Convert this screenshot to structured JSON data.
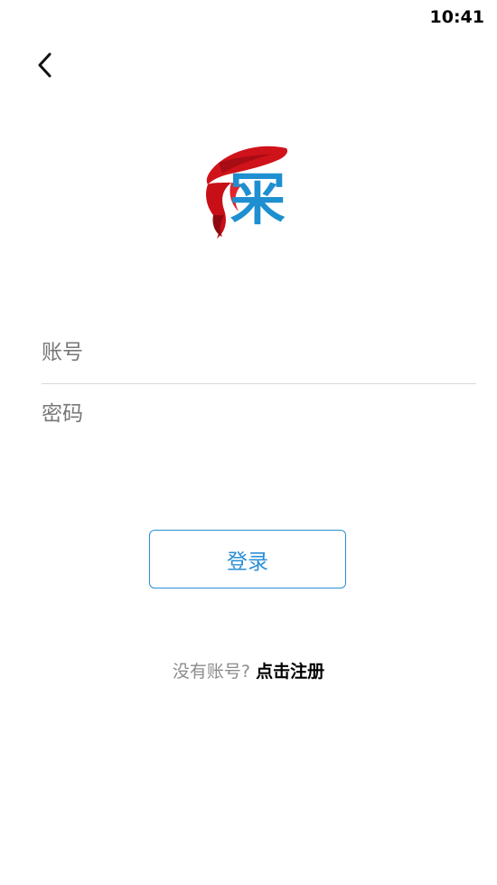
{
  "status_bar": {
    "time": "10:41"
  },
  "logo": {
    "char": "冞",
    "ribbon_color": "#d0121b",
    "char_color": "#1e8fd0"
  },
  "form": {
    "account_placeholder": "账号",
    "password_placeholder": "密码",
    "login_label": "登录"
  },
  "register": {
    "prompt": "没有账号?",
    "link_label": "点击注册"
  },
  "colors": {
    "accent": "#2a8fd6",
    "divider": "#d9d9d9",
    "placeholder": "#777777",
    "muted_text": "#8c8c8c"
  },
  "icons": {
    "back": "chevron-left-icon"
  }
}
